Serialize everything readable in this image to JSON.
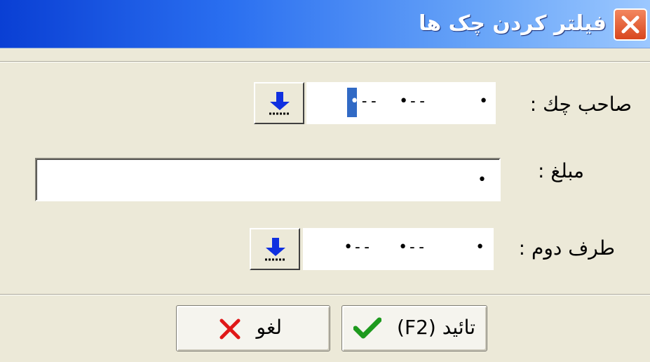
{
  "window": {
    "title": "فیلتر کردن چک ها"
  },
  "fields": {
    "owner_label": "صاحب چك :",
    "amount_label": "مبلغ :",
    "counterparty_label": "طرف دوم :"
  },
  "buttons": {
    "confirm_label": "تائید (F2)",
    "cancel_label": "لغو"
  },
  "colors": {
    "titlebar": "#0a3fd4",
    "close_button": "#d8461e",
    "window_bg": "#ece9d8",
    "arrow_icon": "#1030e0",
    "check_icon": "#1e9a1e",
    "cancel_icon": "#e01818"
  },
  "icons": {
    "close": "close-icon",
    "lookup": "arrow-down-icon",
    "confirm": "checkmark-icon",
    "cancel": "x-icon"
  }
}
